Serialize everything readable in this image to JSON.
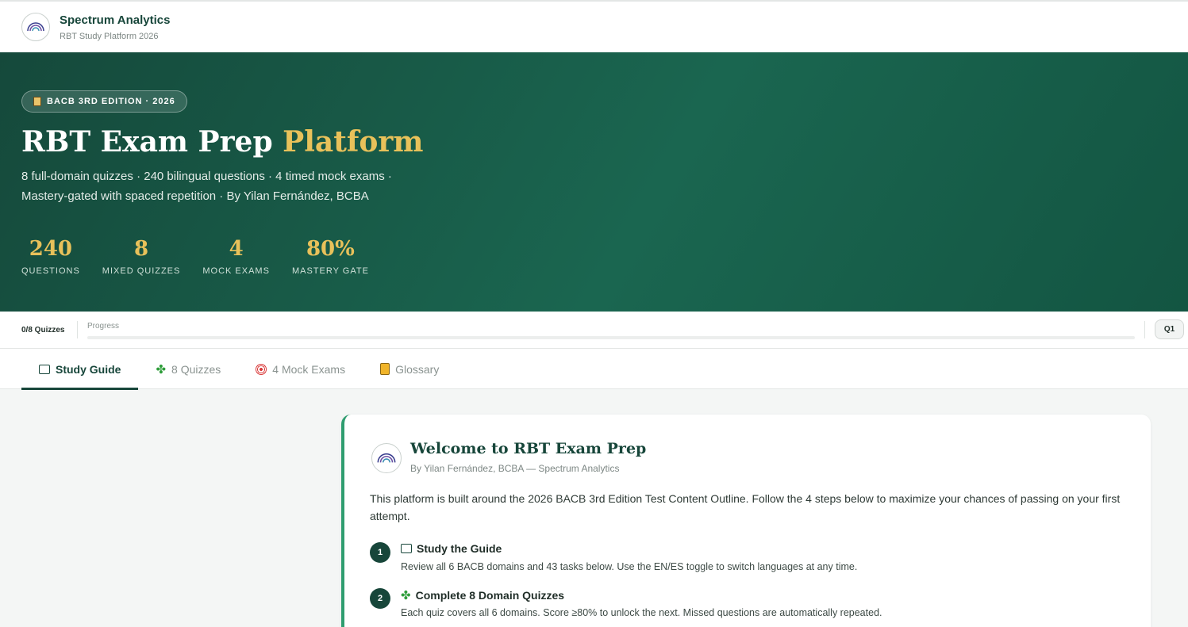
{
  "brand": {
    "name": "Spectrum Analytics",
    "subtitle": "RBT Study Platform 2026"
  },
  "hero": {
    "badge": "BACB 3RD EDITION · 2026",
    "title_main": "RBT Exam Prep ",
    "title_accent": "Platform",
    "description_line1": "8 full-domain quizzes · 240 bilingual questions · 4 timed mock exams ·",
    "description_line2": "Mastery-gated with spaced repetition · By Yilan Fernández, BCBA",
    "stats": [
      {
        "value": "240",
        "label": "QUESTIONS"
      },
      {
        "value": "8",
        "label": "MIXED QUIZZES"
      },
      {
        "value": "4",
        "label": "MOCK EXAMS"
      },
      {
        "value": "80%",
        "label": "MASTERY GATE"
      }
    ]
  },
  "progress": {
    "count": "0/8 Quizzes",
    "label": "Progress",
    "fraction": 0,
    "quiz_button": "Q1"
  },
  "tabs": [
    {
      "label": "Study Guide",
      "icon": "book-icon",
      "active": true
    },
    {
      "label": "8 Quizzes",
      "icon": "clover-icon",
      "active": false
    },
    {
      "label": "4 Mock Exams",
      "icon": "target-icon",
      "active": false
    },
    {
      "label": "Glossary",
      "icon": "notebook-icon",
      "active": false
    }
  ],
  "welcome": {
    "title": "Welcome to RBT Exam Prep",
    "byline": "By Yilan Fernández, BCBA — Spectrum Analytics",
    "intro": "This platform is built around the 2026 BACB 3rd Edition Test Content Outline. Follow the 4 steps below to maximize your chances of passing on your first attempt.",
    "steps": [
      {
        "number": "1",
        "icon": "book-icon",
        "title": "Study the Guide",
        "desc": "Review all 6 BACB domains and 43 tasks below. Use the EN/ES toggle to switch languages at any time."
      },
      {
        "number": "2",
        "icon": "clover-icon",
        "title": "Complete 8 Domain Quizzes",
        "desc": "Each quiz covers all 6 domains. Score ≥80% to unlock the next. Missed questions are automatically repeated."
      }
    ]
  },
  "colors": {
    "primary": "#17463a",
    "accent_gold": "#e8c15a",
    "card_border": "#2f9d70"
  }
}
